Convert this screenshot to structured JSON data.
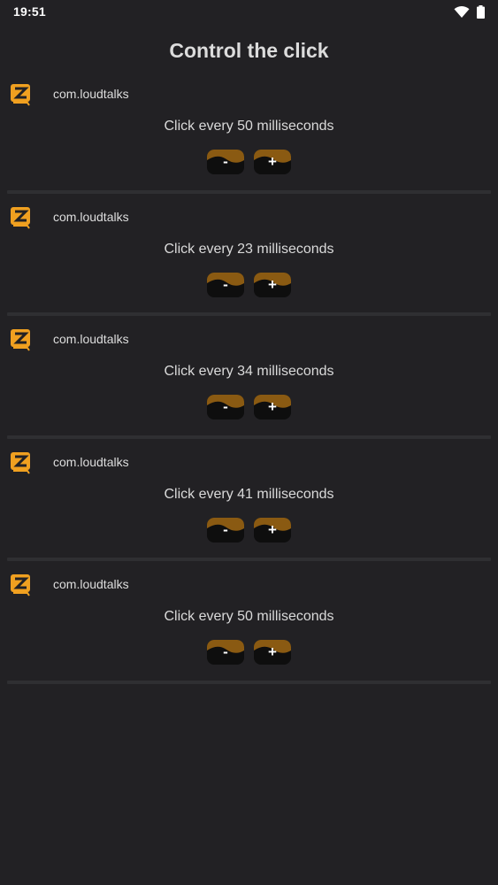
{
  "status": {
    "time": "19:51"
  },
  "title": "Control the click",
  "colors": {
    "accent": "#f0a020",
    "button_wave": "#8a5a12",
    "background": "#222124"
  },
  "items": [
    {
      "package": "com.loudtalks",
      "text": "Click every 50 milliseconds",
      "minus": "-",
      "plus": "+"
    },
    {
      "package": "com.loudtalks",
      "text": "Click every 23 milliseconds",
      "minus": "-",
      "plus": "+"
    },
    {
      "package": "com.loudtalks",
      "text": "Click every 34 milliseconds",
      "minus": "-",
      "plus": "+"
    },
    {
      "package": "com.loudtalks",
      "text": "Click every 41 milliseconds",
      "minus": "-",
      "plus": "+"
    },
    {
      "package": "com.loudtalks",
      "text": "Click every 50 milliseconds",
      "minus": "-",
      "plus": "+"
    }
  ]
}
